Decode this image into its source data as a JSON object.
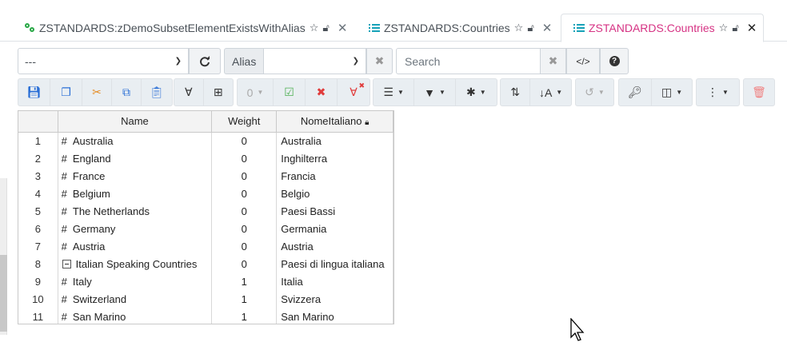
{
  "tabs": [
    {
      "title": "ZSTANDARDS:zDemoSubsetElementExistsWithAlias",
      "icon": "subset-icon",
      "active": false
    },
    {
      "title": "ZSTANDARDS:Countries",
      "icon": "list-icon",
      "active": false
    },
    {
      "title": "ZSTANDARDS:Countries",
      "icon": "list-icon",
      "active": true
    }
  ],
  "controls": {
    "subset_select_value": "---",
    "alias_label": "Alias",
    "alias_select_value": "",
    "search_placeholder": "Search",
    "zero_counter": "0"
  },
  "table": {
    "headers": {
      "row_num": "",
      "name": "Name",
      "weight": "Weight",
      "nome": "NomeItaliano"
    },
    "rows": [
      {
        "n": "1",
        "prefix": "#",
        "name": "Australia",
        "weight": "0",
        "nome": "Australia"
      },
      {
        "n": "2",
        "prefix": "#",
        "name": "England",
        "weight": "0",
        "nome": "Inghilterra"
      },
      {
        "n": "3",
        "prefix": "#",
        "name": "France",
        "weight": "0",
        "nome": "Francia"
      },
      {
        "n": "4",
        "prefix": "#",
        "name": "Belgium",
        "weight": "0",
        "nome": "Belgio"
      },
      {
        "n": "5",
        "prefix": "#",
        "name": "The Netherlands",
        "weight": "0",
        "nome": "Paesi Bassi"
      },
      {
        "n": "6",
        "prefix": "#",
        "name": "Germany",
        "weight": "0",
        "nome": "Germania"
      },
      {
        "n": "7",
        "prefix": "#",
        "name": "Austria",
        "weight": "0",
        "nome": "Austria"
      },
      {
        "n": "8",
        "prefix": "",
        "name": "Italian Speaking Countries",
        "weight": "0",
        "nome": "Paesi di lingua italiana"
      },
      {
        "n": "9",
        "prefix": "#",
        "name": "Italy",
        "weight": "1",
        "nome": "Italia"
      },
      {
        "n": "10",
        "prefix": "#",
        "name": "Switzerland",
        "weight": "1",
        "nome": "Svizzera"
      },
      {
        "n": "11",
        "prefix": "#",
        "name": "San Marino",
        "weight": "1",
        "nome": "San Marino"
      }
    ]
  },
  "colors": {
    "active_tab_title": "#d63384",
    "tab_icon": "#17a2b8",
    "subset_icon": "#28a745"
  }
}
